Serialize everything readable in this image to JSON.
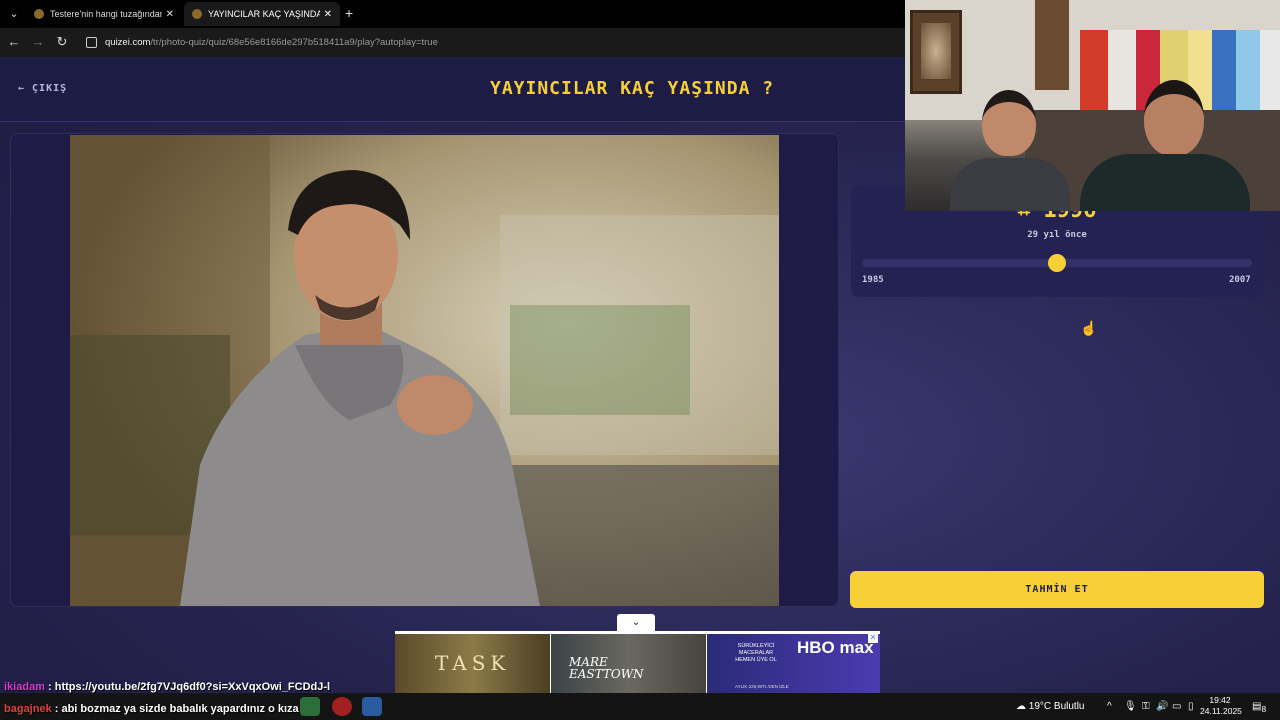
{
  "browser": {
    "tabs": [
      {
        "label": "Testere'nin hangi tuzağından k",
        "close": "✕"
      },
      {
        "label": "YAYINCILAR KAÇ YAŞINDA ? - Q",
        "close": "✕"
      }
    ],
    "new_tab": "+",
    "tab_menu": "⌄",
    "url_host": "quizei.com",
    "url_path": "/tr/photo-quiz/quiz/68e56e8166de297b518411a9/play?autoplay=true"
  },
  "page": {
    "exit_label": "← ÇIKIŞ",
    "title": "YAYINCILAR KAÇ YAŞINDA ?",
    "guess": {
      "year_prefix": "⌗",
      "year": "1996",
      "years_ago": "29 yıl önce",
      "slider_min": "1985",
      "slider_max": "2007",
      "slider_value": 1996
    },
    "submit_label": "TAHMİN ET",
    "collapse_icon": "⌄"
  },
  "ad": {
    "panel1_text": "TASK",
    "panel2_line1": "MARE",
    "panel2_line2": "EASTTOWN",
    "panel3_promo": "SÜRÜKLEYİCİ MACERALAR",
    "panel3_cta": "HEMEN ÜYE OL",
    "panel3_logo": "HBO max",
    "panel3_terms": "AYLIK 229,90TL'DEN İZLE"
  },
  "chat": [
    {
      "user": "ikiadam",
      "sep": " : ",
      "message": "https://youtu.be/2fg7VJq6df0?si=XxVqxOwi_FCDdJ-l"
    },
    {
      "user": "bagajnek",
      "sep": " : ",
      "message": "abi bozmaz ya sizde babalık yapardınız o kıza"
    }
  ],
  "taskbar": {
    "weather": "19°C Bulutlu",
    "time": "19:42",
    "date": "24.11.2025",
    "notifications": "8"
  },
  "colors": {
    "accent": "#f7d038",
    "page_bg": "#26244f",
    "header_bg": "#1d1c45"
  }
}
